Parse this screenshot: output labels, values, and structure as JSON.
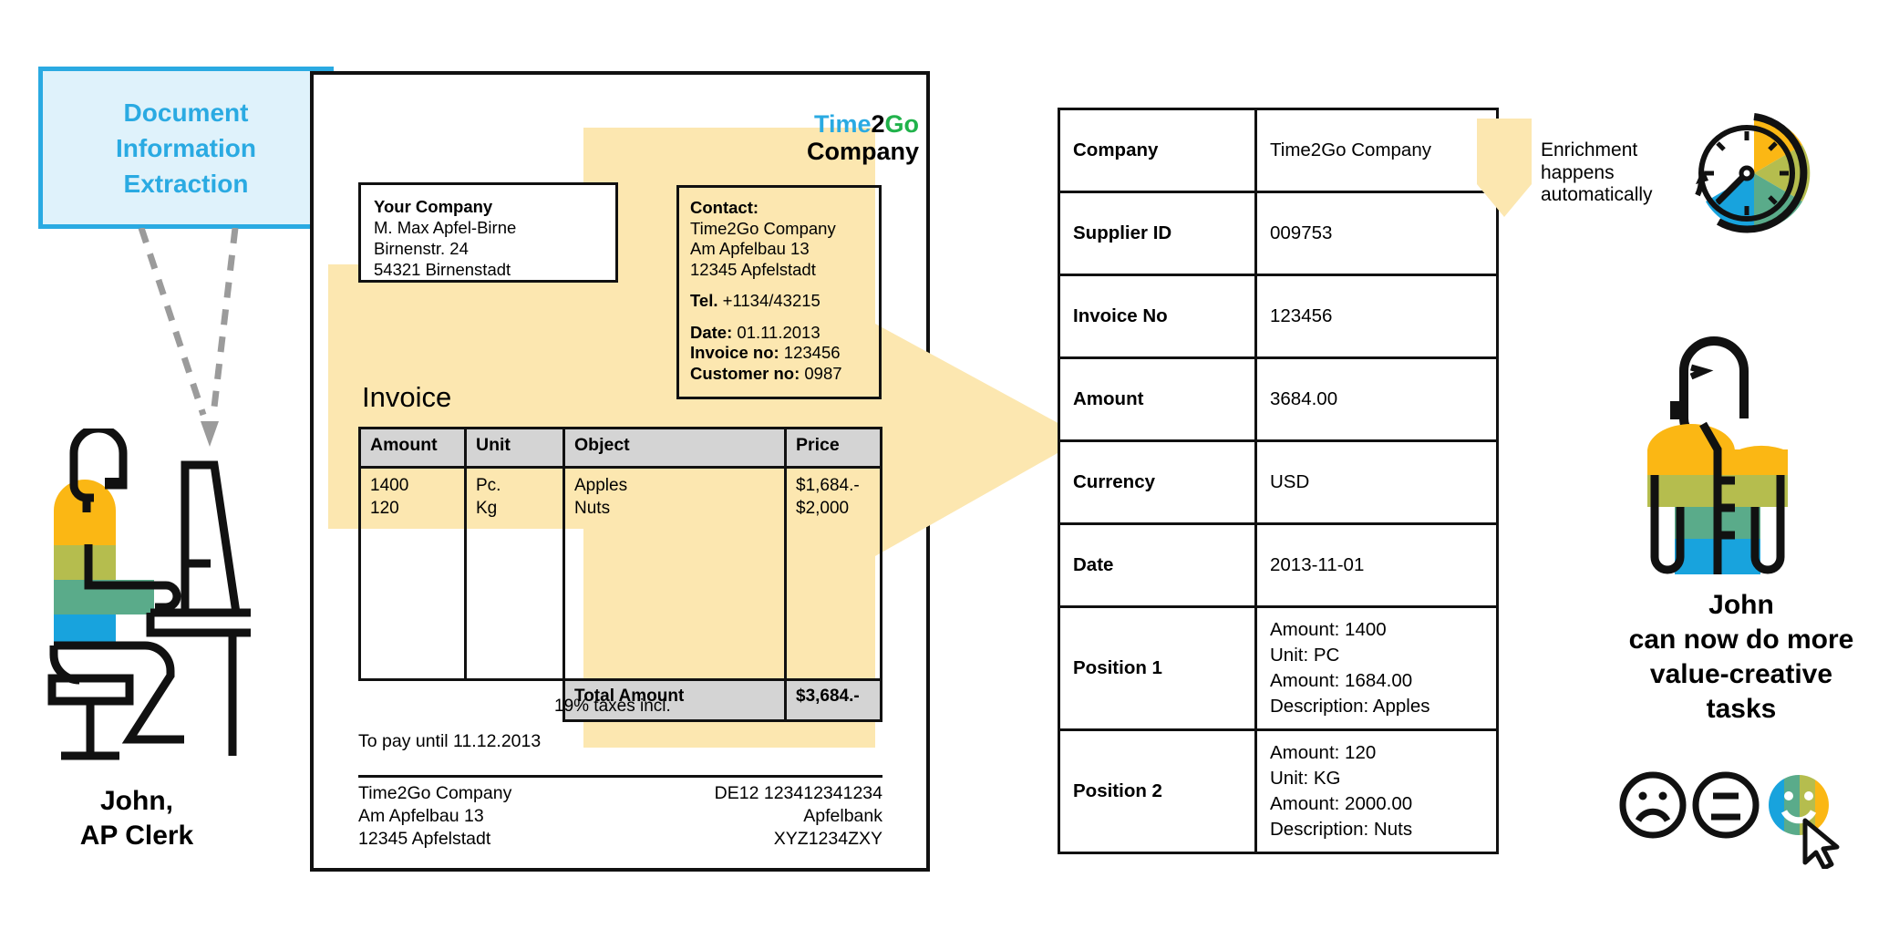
{
  "die_box": {
    "line1": "Document",
    "line2": "Information",
    "line3": "Extraction",
    "color": "#2aaae2",
    "fill": "#dff2fb"
  },
  "left_person": {
    "label_line1": "John,",
    "label_line2": "AP Clerk",
    "icon": "person-at-desk-icon"
  },
  "invoice": {
    "logo": {
      "part1": "Time",
      "part2": "2",
      "part3": "Go",
      "subtitle": "Company",
      "color1": "#2aaae2",
      "color2": "#000000",
      "color3": "#21b24b"
    },
    "your_company": {
      "heading": "Your Company",
      "lines": [
        "M. Max Apfel-Birne",
        "Birnenstr. 24",
        "54321 Birnenstadt"
      ]
    },
    "contact": {
      "heading": "Contact:",
      "lines": [
        "Time2Go Company",
        "Am Apfelbau 13",
        "12345 Apfelstadt"
      ],
      "tel_label": "Tel.",
      "tel_value": "+1134/43215",
      "date_label": "Date:",
      "date_value": "01.11.2013",
      "invoice_no_label": "Invoice no:",
      "invoice_no_value": "123456",
      "customer_no_label": "Customer no:",
      "customer_no_value": "0987"
    },
    "title": "Invoice",
    "table": {
      "headers": [
        "Amount",
        "Unit",
        "Object",
        "Price"
      ],
      "rows_amount": [
        "1400",
        "120"
      ],
      "rows_unit": [
        "Pc.",
        "Kg"
      ],
      "rows_object": [
        "Apples",
        "Nuts"
      ],
      "rows_price": [
        "$1,684.-",
        "$2,000"
      ],
      "total_label": "Total Amount",
      "total_value": "$3,684.-"
    },
    "taxes_note": "19% taxes incl.",
    "pay_until": "To pay until 11.12.2013",
    "footer_left": [
      "Time2Go Company",
      "Am Apfelbau 13",
      "12345 Apfelstadt"
    ],
    "footer_right": [
      "DE12 123412341234",
      "Apfelbank",
      "XYZ1234ZXY"
    ]
  },
  "extraction": {
    "rows": [
      {
        "key": "Company",
        "value": "Time2Go Company"
      },
      {
        "key": "Supplier ID",
        "value": "009753"
      },
      {
        "key": "Invoice No",
        "value": "123456"
      },
      {
        "key": "Amount",
        "value": "3684.00"
      },
      {
        "key": "Currency",
        "value": "USD"
      },
      {
        "key": "Date",
        "value": "2013-11-01"
      }
    ],
    "position1": {
      "key": "Position 1",
      "lines": [
        "Amount: 1400",
        "Unit: PC",
        "Amount: 1684.00",
        "Description: Apples"
      ]
    },
    "position2": {
      "key": "Position 2",
      "lines": [
        "Amount: 120",
        "Unit: KG",
        "Amount: 2000.00",
        "Description: Nuts"
      ]
    }
  },
  "enrichment": {
    "line1": "Enrichment",
    "line2": "happens",
    "line3": "automatically",
    "icon": "down-arrow-callout-icon"
  },
  "clock": {
    "icon": "clock-pie-icon",
    "colors": [
      "#fbb714",
      "#b5bd4e",
      "#5aab8a",
      "#18a3dd"
    ]
  },
  "right_person": {
    "icon": "person-standing-icon",
    "label_line1": "John",
    "label_line2": "can now do more",
    "label_line3": "value-creative",
    "label_line4": "tasks"
  },
  "smileys": {
    "sad_icon": "sad-face-icon",
    "neutral_icon": "neutral-face-icon",
    "happy_icon": "happy-face-icon",
    "cursor_icon": "mouse-cursor-icon"
  },
  "colors": {
    "brand_blue": "#2aaae2",
    "brand_green": "#21b24b",
    "highlight_yellow": "#fce7b0",
    "orange": "#fbb714",
    "olive": "#b5bd4e",
    "teal": "#5aab8a",
    "cyan": "#18a3dd"
  }
}
